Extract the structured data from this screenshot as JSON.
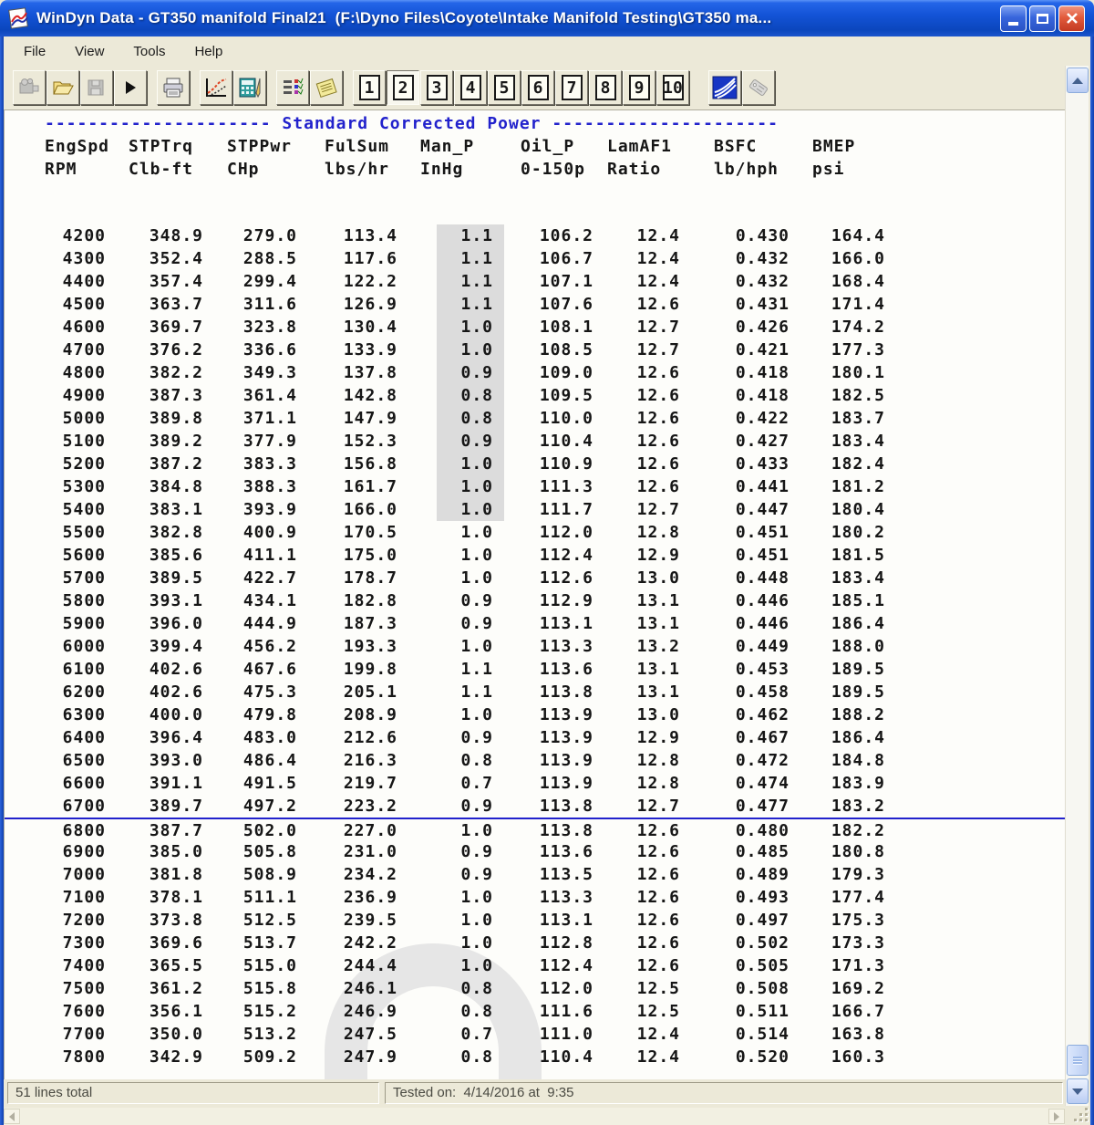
{
  "window": {
    "title": "WinDyn Data - GT350 manifold Final21  (F:\\Dyno Files\\Coyote\\Intake Manifold Testing\\GT350 ma...",
    "controls": [
      "minimize",
      "maximize",
      "close"
    ]
  },
  "menu": {
    "items": [
      "File",
      "View",
      "Tools",
      "Help"
    ]
  },
  "toolbar": {
    "icons": [
      "new-test",
      "open-folder",
      "save-file",
      "play",
      "print",
      "graph-edit",
      "calculator-edit",
      "test-list",
      "notes",
      "superflow-graph",
      "tag"
    ],
    "page_buttons": [
      "1",
      "2",
      "3",
      "4",
      "5",
      "6",
      "7",
      "8",
      "9",
      "10"
    ],
    "active_page": "2"
  },
  "report": {
    "dashes_left": "---------------------",
    "section_title": "Standard Corrected Power",
    "dashes_right": "---------------------",
    "columns": [
      {
        "name": "EngSpd",
        "unit": "RPM"
      },
      {
        "name": "STPTrq",
        "unit": "Clb-ft"
      },
      {
        "name": "STPPwr",
        "unit": "CHp"
      },
      {
        "name": "FulSum",
        "unit": "lbs/hr"
      },
      {
        "name": "Man_P",
        "unit": "InHg"
      },
      {
        "name": "Oil_P",
        "unit": "0-150p"
      },
      {
        "name": "LamAF1",
        "unit": "Ratio"
      },
      {
        "name": "BSFC",
        "unit": "lb/hph"
      },
      {
        "name": "BMEP",
        "unit": "psi"
      }
    ],
    "man_p_highlight_through_rpm": "5400",
    "separator_above_rpm": "6800",
    "rows": [
      [
        "4200",
        "348.9",
        "279.0",
        "113.4",
        "1.1",
        "106.2",
        "12.4",
        "0.430",
        "164.4"
      ],
      [
        "4300",
        "352.4",
        "288.5",
        "117.6",
        "1.1",
        "106.7",
        "12.4",
        "0.432",
        "166.0"
      ],
      [
        "4400",
        "357.4",
        "299.4",
        "122.2",
        "1.1",
        "107.1",
        "12.4",
        "0.432",
        "168.4"
      ],
      [
        "4500",
        "363.7",
        "311.6",
        "126.9",
        "1.1",
        "107.6",
        "12.6",
        "0.431",
        "171.4"
      ],
      [
        "4600",
        "369.7",
        "323.8",
        "130.4",
        "1.0",
        "108.1",
        "12.7",
        "0.426",
        "174.2"
      ],
      [
        "4700",
        "376.2",
        "336.6",
        "133.9",
        "1.0",
        "108.5",
        "12.7",
        "0.421",
        "177.3"
      ],
      [
        "4800",
        "382.2",
        "349.3",
        "137.8",
        "0.9",
        "109.0",
        "12.6",
        "0.418",
        "180.1"
      ],
      [
        "4900",
        "387.3",
        "361.4",
        "142.8",
        "0.8",
        "109.5",
        "12.6",
        "0.418",
        "182.5"
      ],
      [
        "5000",
        "389.8",
        "371.1",
        "147.9",
        "0.8",
        "110.0",
        "12.6",
        "0.422",
        "183.7"
      ],
      [
        "5100",
        "389.2",
        "377.9",
        "152.3",
        "0.9",
        "110.4",
        "12.6",
        "0.427",
        "183.4"
      ],
      [
        "5200",
        "387.2",
        "383.3",
        "156.8",
        "1.0",
        "110.9",
        "12.6",
        "0.433",
        "182.4"
      ],
      [
        "5300",
        "384.8",
        "388.3",
        "161.7",
        "1.0",
        "111.3",
        "12.6",
        "0.441",
        "181.2"
      ],
      [
        "5400",
        "383.1",
        "393.9",
        "166.0",
        "1.0",
        "111.7",
        "12.7",
        "0.447",
        "180.4"
      ],
      [
        "5500",
        "382.8",
        "400.9",
        "170.5",
        "1.0",
        "112.0",
        "12.8",
        "0.451",
        "180.2"
      ],
      [
        "5600",
        "385.6",
        "411.1",
        "175.0",
        "1.0",
        "112.4",
        "12.9",
        "0.451",
        "181.5"
      ],
      [
        "5700",
        "389.5",
        "422.7",
        "178.7",
        "1.0",
        "112.6",
        "13.0",
        "0.448",
        "183.4"
      ],
      [
        "5800",
        "393.1",
        "434.1",
        "182.8",
        "0.9",
        "112.9",
        "13.1",
        "0.446",
        "185.1"
      ],
      [
        "5900",
        "396.0",
        "444.9",
        "187.3",
        "0.9",
        "113.1",
        "13.1",
        "0.446",
        "186.4"
      ],
      [
        "6000",
        "399.4",
        "456.2",
        "193.3",
        "1.0",
        "113.3",
        "13.2",
        "0.449",
        "188.0"
      ],
      [
        "6100",
        "402.6",
        "467.6",
        "199.8",
        "1.1",
        "113.6",
        "13.1",
        "0.453",
        "189.5"
      ],
      [
        "6200",
        "402.6",
        "475.3",
        "205.1",
        "1.1",
        "113.8",
        "13.1",
        "0.458",
        "189.5"
      ],
      [
        "6300",
        "400.0",
        "479.8",
        "208.9",
        "1.0",
        "113.9",
        "13.0",
        "0.462",
        "188.2"
      ],
      [
        "6400",
        "396.4",
        "483.0",
        "212.6",
        "0.9",
        "113.9",
        "12.9",
        "0.467",
        "186.4"
      ],
      [
        "6500",
        "393.0",
        "486.4",
        "216.3",
        "0.8",
        "113.9",
        "12.8",
        "0.472",
        "184.8"
      ],
      [
        "6600",
        "391.1",
        "491.5",
        "219.7",
        "0.7",
        "113.9",
        "12.8",
        "0.474",
        "183.9"
      ],
      [
        "6700",
        "389.7",
        "497.2",
        "223.2",
        "0.9",
        "113.8",
        "12.7",
        "0.477",
        "183.2"
      ],
      [
        "6800",
        "387.7",
        "502.0",
        "227.0",
        "1.0",
        "113.8",
        "12.6",
        "0.480",
        "182.2"
      ],
      [
        "6900",
        "385.0",
        "505.8",
        "231.0",
        "0.9",
        "113.6",
        "12.6",
        "0.485",
        "180.8"
      ],
      [
        "7000",
        "381.8",
        "508.9",
        "234.2",
        "0.9",
        "113.5",
        "12.6",
        "0.489",
        "179.3"
      ],
      [
        "7100",
        "378.1",
        "511.1",
        "236.9",
        "1.0",
        "113.3",
        "12.6",
        "0.493",
        "177.4"
      ],
      [
        "7200",
        "373.8",
        "512.5",
        "239.5",
        "1.0",
        "113.1",
        "12.6",
        "0.497",
        "175.3"
      ],
      [
        "7300",
        "369.6",
        "513.7",
        "242.2",
        "1.0",
        "112.8",
        "12.6",
        "0.502",
        "173.3"
      ],
      [
        "7400",
        "365.5",
        "515.0",
        "244.4",
        "1.0",
        "112.4",
        "12.6",
        "0.505",
        "171.3"
      ],
      [
        "7500",
        "361.2",
        "515.8",
        "246.1",
        "0.8",
        "112.0",
        "12.5",
        "0.508",
        "169.2"
      ],
      [
        "7600",
        "356.1",
        "515.2",
        "246.9",
        "0.8",
        "111.6",
        "12.5",
        "0.511",
        "166.7"
      ],
      [
        "7700",
        "350.0",
        "513.2",
        "247.5",
        "0.7",
        "111.0",
        "12.4",
        "0.514",
        "163.8"
      ],
      [
        "7800",
        "342.9",
        "509.2",
        "247.9",
        "0.8",
        "110.4",
        "12.4",
        "0.520",
        "160.3"
      ]
    ]
  },
  "statusbar": {
    "lines_total": "51 lines total",
    "tested_on": "Tested on:  4/14/2016 at  9:35"
  },
  "colors": {
    "header_blue": "#2222cc",
    "separator_blue": "#2222cc",
    "man_p_highlight_gray": "#dcdcdc",
    "titlebar_blue": "#1353d6",
    "close_red": "#d94a2e"
  }
}
